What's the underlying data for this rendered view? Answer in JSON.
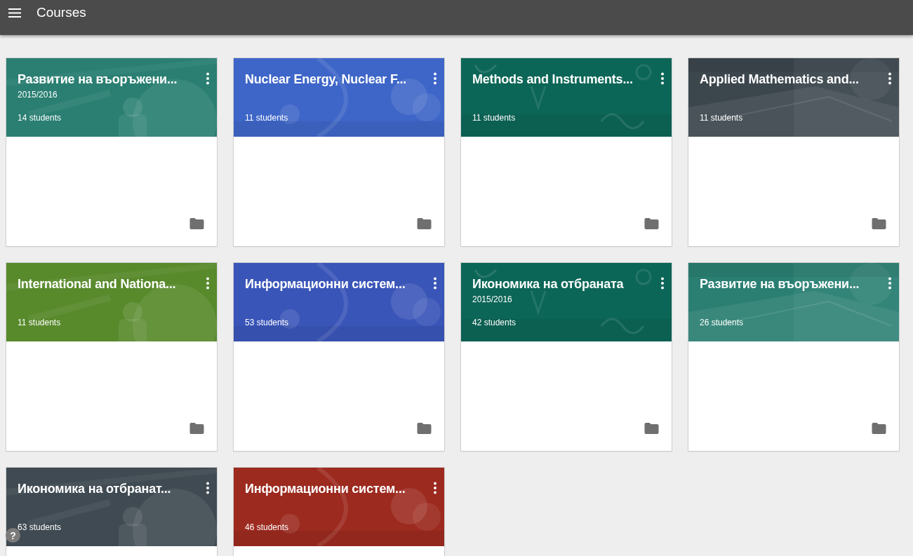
{
  "app_bar": {
    "title": "Courses"
  },
  "courses": [
    {
      "title": "Развитие на въоръжени...",
      "term": "2015/2016",
      "students": "14 students",
      "color": "#2a7f72"
    },
    {
      "title": "Nuclear Energy, Nuclear F...",
      "students": "11 students",
      "color": "#3e66c8"
    },
    {
      "title": "Methods and Instruments...",
      "students": "11 students",
      "color": "#0c6657"
    },
    {
      "title": "Applied Mathematics and...",
      "students": "11 students",
      "color": "#3c464d"
    },
    {
      "title": "International and Nationa...",
      "students": "11 students",
      "color": "#588a2c"
    },
    {
      "title": "Информационни систем...",
      "students": "53 students",
      "color": "#3a55b8"
    },
    {
      "title": "Икономика на отбраната",
      "term": "2015/2016",
      "students": "42 students",
      "color": "#0c6657"
    },
    {
      "title": "Развитие на въоръжени...",
      "students": "26 students",
      "color": "#2a7f72"
    },
    {
      "title": "Икономика на отбранат...",
      "students": "63 students",
      "color": "#3f4a52"
    },
    {
      "title": "Информационни систем...",
      "students": "46 students",
      "color": "#9c2a1f"
    }
  ],
  "help_button": "?"
}
